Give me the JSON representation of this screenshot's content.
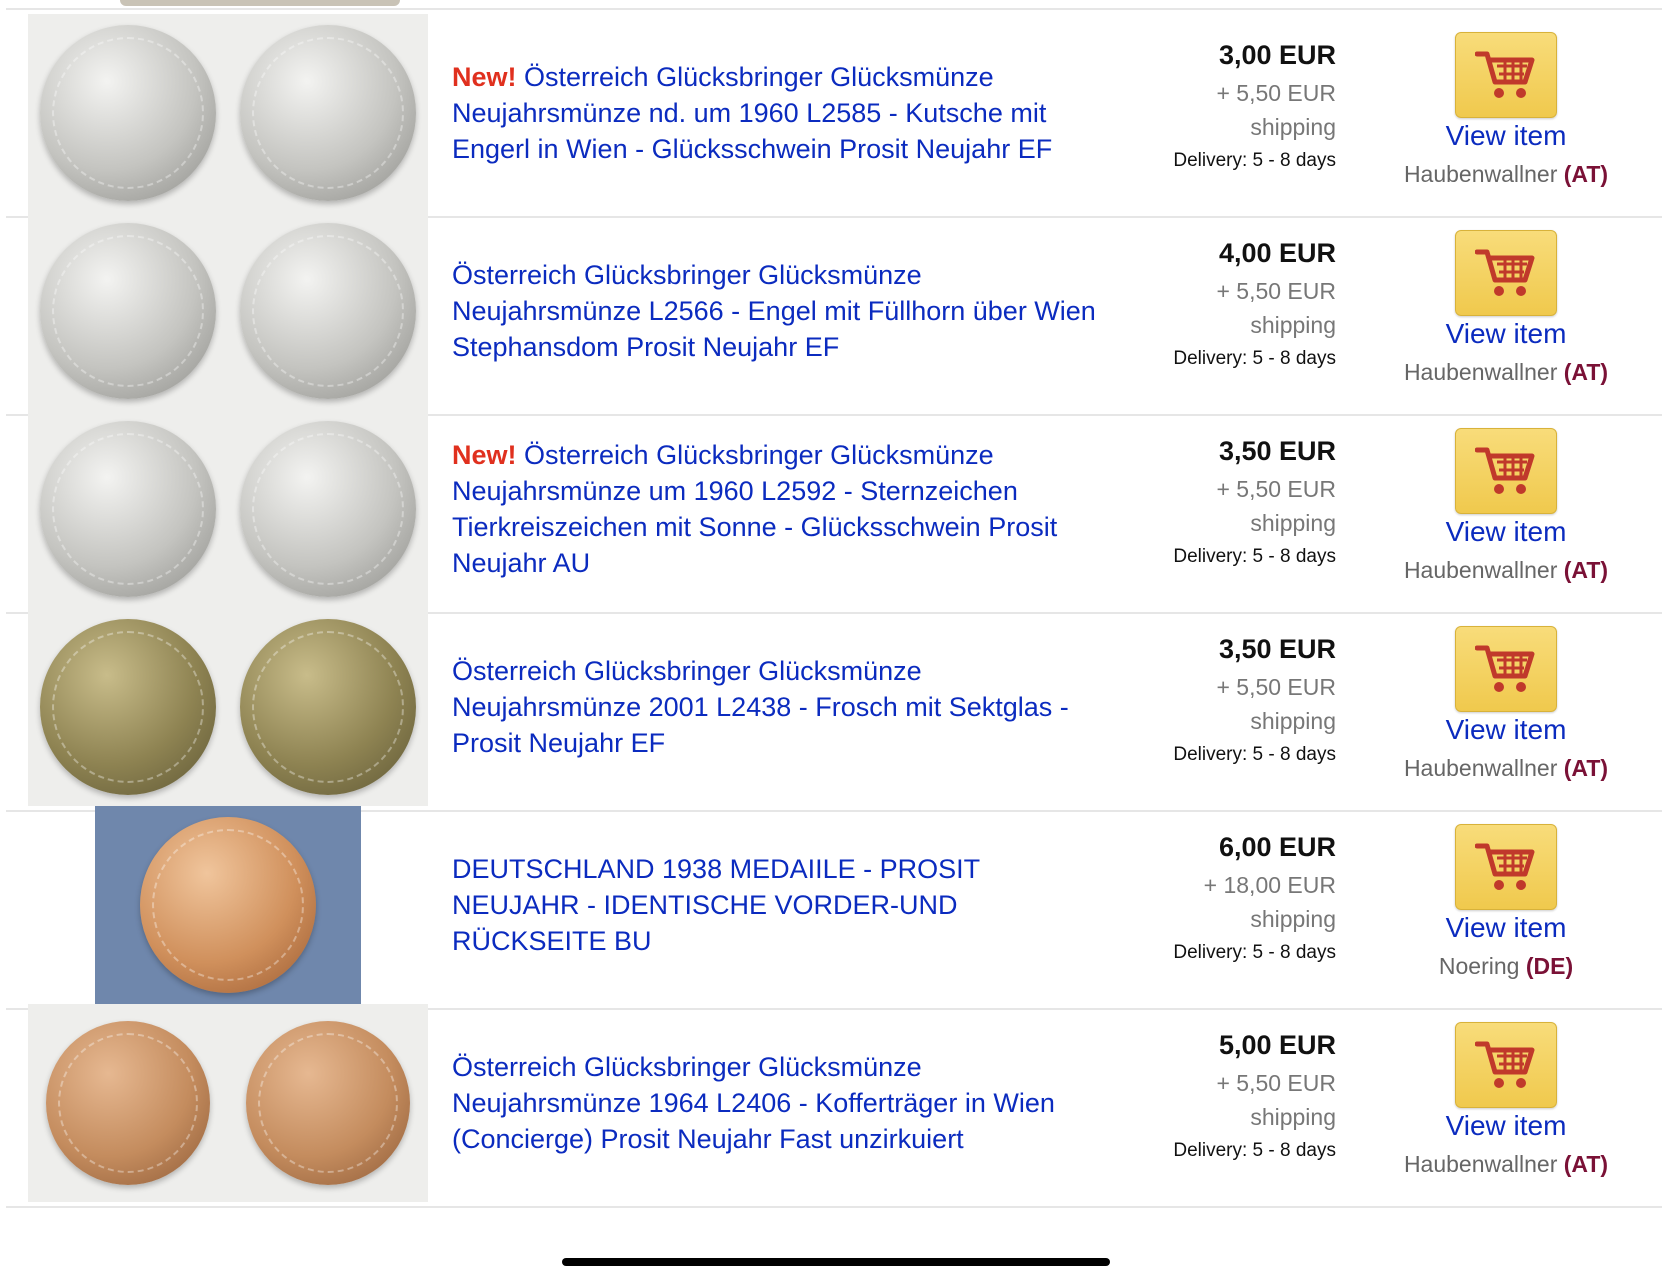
{
  "colors": {
    "link": "#0b2bbf",
    "new_badge": "#e0301e",
    "country": "#7a1136",
    "cart_button": "#f0c94d"
  },
  "listings": [
    {
      "new_label": "New!",
      "title": "Österreich Glücksbringer Glücksmünze Neujahrsmünze nd. um 1960 L2585 - Kutsche mit Engerl in Wien - Glücksschwein Prosit Neujahr EF",
      "price": "3,00 EUR",
      "shipping": "+ 5,50 EUR",
      "shipping_label": "shipping",
      "delivery": "Delivery: 5 - 8 days",
      "view_label": "View item",
      "seller": "Haubenwallner",
      "country": "(AT)"
    },
    {
      "new_label": "",
      "title": "Österreich Glücksbringer Glücksmünze Neujahrsmünze L2566 - Engel mit Füllhorn über Wien Stephansdom Prosit Neujahr EF",
      "price": "4,00 EUR",
      "shipping": "+ 5,50 EUR",
      "shipping_label": "shipping",
      "delivery": "Delivery: 5 - 8 days",
      "view_label": "View item",
      "seller": "Haubenwallner",
      "country": "(AT)"
    },
    {
      "new_label": "New!",
      "title": "Österreich Glücksbringer Glücksmünze Neujahrsmünze um 1960 L2592 - Sternzeichen Tierkreiszeichen mit Sonne - Glücksschwein Prosit Neujahr AU",
      "price": "3,50 EUR",
      "shipping": "+ 5,50 EUR",
      "shipping_label": "shipping",
      "delivery": "Delivery: 5 - 8 days",
      "view_label": "View item",
      "seller": "Haubenwallner",
      "country": "(AT)"
    },
    {
      "new_label": "",
      "title": "Österreich Glücksbringer Glücksmünze Neujahrsmünze 2001 L2438 - Frosch mit Sektglas - Prosit Neujahr EF",
      "price": "3,50 EUR",
      "shipping": "+ 5,50 EUR",
      "shipping_label": "shipping",
      "delivery": "Delivery: 5 - 8 days",
      "view_label": "View item",
      "seller": "Haubenwallner",
      "country": "(AT)"
    },
    {
      "new_label": "",
      "title": "DEUTSCHLAND 1938 MEDAIILE - PROSIT NEUJAHR - IDENTISCHE VORDER-UND RÜCKSEITE BU",
      "price": "6,00 EUR",
      "shipping": "+ 18,00 EUR",
      "shipping_label": "shipping",
      "delivery": "Delivery: 5 - 8 days",
      "view_label": "View item",
      "seller": "Noering",
      "country": "(DE)"
    },
    {
      "new_label": "",
      "title": "Österreich Glücksbringer Glücksmünze Neujahrsmünze 1964 L2406 - Kofferträger in Wien (Concierge) Prosit Neujahr Fast unzirkuiert",
      "price": "5,00 EUR",
      "shipping": "+ 5,50 EUR",
      "shipping_label": "shipping",
      "delivery": "Delivery: 5 - 8 days",
      "view_label": "View item",
      "seller": "Haubenwallner",
      "country": "(AT)"
    }
  ]
}
